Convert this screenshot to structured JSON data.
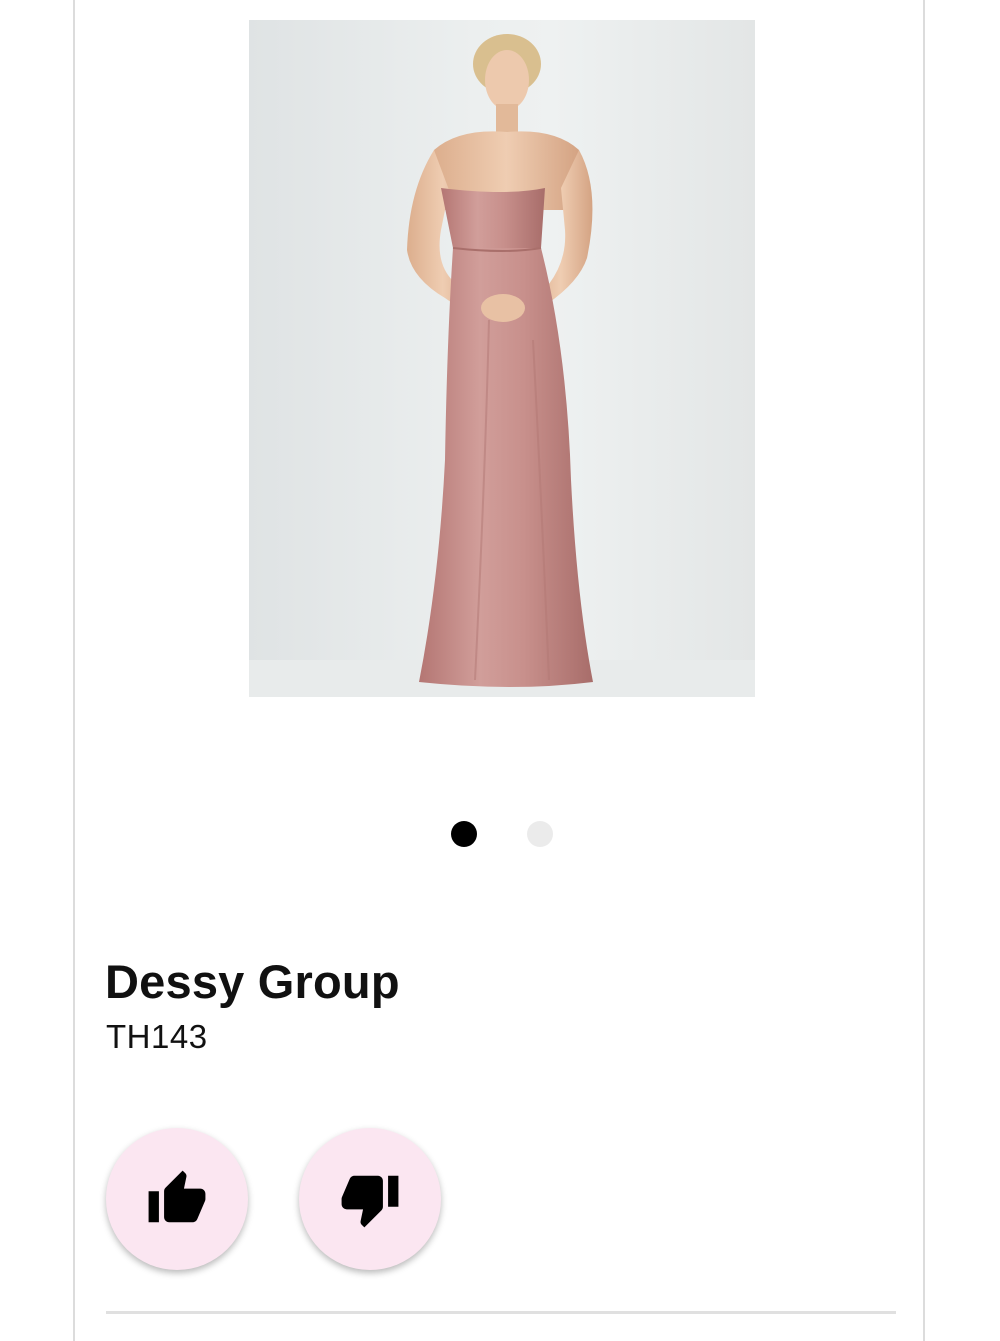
{
  "product": {
    "brand": "Dessy Group",
    "sku": "TH143",
    "image_alt_icon": "dress-photo",
    "dress_color": "#c48a86"
  },
  "carousel": {
    "total": 2,
    "active_index": 0,
    "active_color": "#000000",
    "inactive_color": "#ebebeb"
  },
  "actions": {
    "like_icon": "thumbs-up-icon",
    "dislike_icon": "thumbs-down-icon",
    "button_color": "#fbe6f1"
  }
}
